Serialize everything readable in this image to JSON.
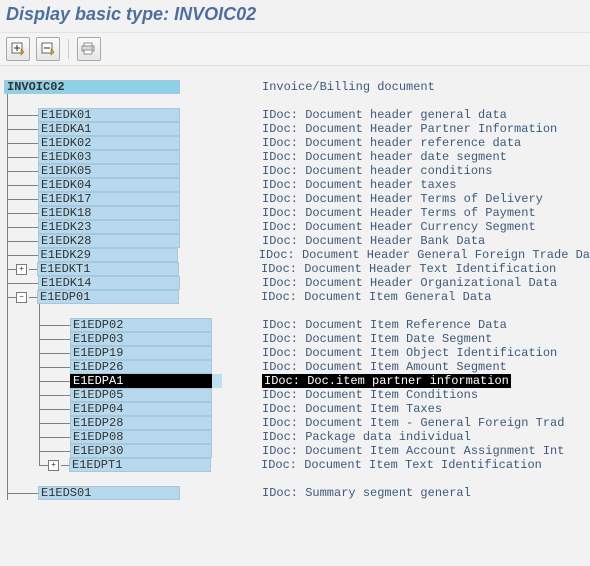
{
  "title": "Display basic type: INVOIC02",
  "toolbar": {
    "expand": "expand-all",
    "collapse": "collapse-all",
    "print": "print"
  },
  "root": {
    "seg": "INVOIC02",
    "desc": "Invoice/Billing document"
  },
  "lvl1": [
    {
      "seg": "E1EDK01",
      "desc": "IDoc: Document header general data"
    },
    {
      "seg": "E1EDKA1",
      "desc": "IDoc: Document Header Partner Information"
    },
    {
      "seg": "E1EDK02",
      "desc": "IDoc: Document header reference data"
    },
    {
      "seg": "E1EDK03",
      "desc": "IDoc: Document header date segment"
    },
    {
      "seg": "E1EDK05",
      "desc": "IDoc: Document header conditions"
    },
    {
      "seg": "E1EDK04",
      "desc": "IDoc: Document header taxes"
    },
    {
      "seg": "E1EDK17",
      "desc": "IDoc: Document Header Terms of Delivery"
    },
    {
      "seg": "E1EDK18",
      "desc": "IDoc: Document Header Terms of Payment"
    },
    {
      "seg": "E1EDK23",
      "desc": "IDoc: Document Header Currency Segment"
    },
    {
      "seg": "E1EDK28",
      "desc": "IDoc: Document Header Bank Data"
    },
    {
      "seg": "E1EDK29",
      "desc": "IDoc: Document Header General Foreign Trade Da"
    },
    {
      "seg": "E1EDKT1",
      "desc": "IDoc: Document Header Text Identification",
      "exp": "+"
    },
    {
      "seg": "E1EDK14",
      "desc": "IDoc: Document Header Organizational Data"
    },
    {
      "seg": "E1EDP01",
      "desc": "IDoc: Document Item General Data",
      "exp": "-"
    }
  ],
  "lvl2": [
    {
      "seg": "E1EDP02",
      "desc": "IDoc: Document Item Reference Data"
    },
    {
      "seg": "E1EDP03",
      "desc": "IDoc: Document Item Date Segment"
    },
    {
      "seg": "E1EDP19",
      "desc": "IDoc: Document Item Object Identification"
    },
    {
      "seg": "E1EDP26",
      "desc": "IDoc: Document Item Amount Segment"
    },
    {
      "seg": "E1EDPA1",
      "desc": "IDoc: Doc.item partner information",
      "sel": true
    },
    {
      "seg": "E1EDP05",
      "desc": "IDoc: Document Item Conditions"
    },
    {
      "seg": "E1EDP04",
      "desc": "IDoc: Document Item Taxes"
    },
    {
      "seg": "E1EDP28",
      "desc": "IDoc: Document Item - General Foreign Trad"
    },
    {
      "seg": "E1EDP08",
      "desc": "IDoc: Package data individual"
    },
    {
      "seg": "E1EDP30",
      "desc": "IDoc: Document Item Account Assignment Int"
    },
    {
      "seg": "E1EDPT1",
      "desc": "IDoc: Document Item Text Identification",
      "exp": "+",
      "last": true
    }
  ],
  "tail": {
    "seg": "E1EDS01",
    "desc": "IDoc: Summary segment general"
  }
}
